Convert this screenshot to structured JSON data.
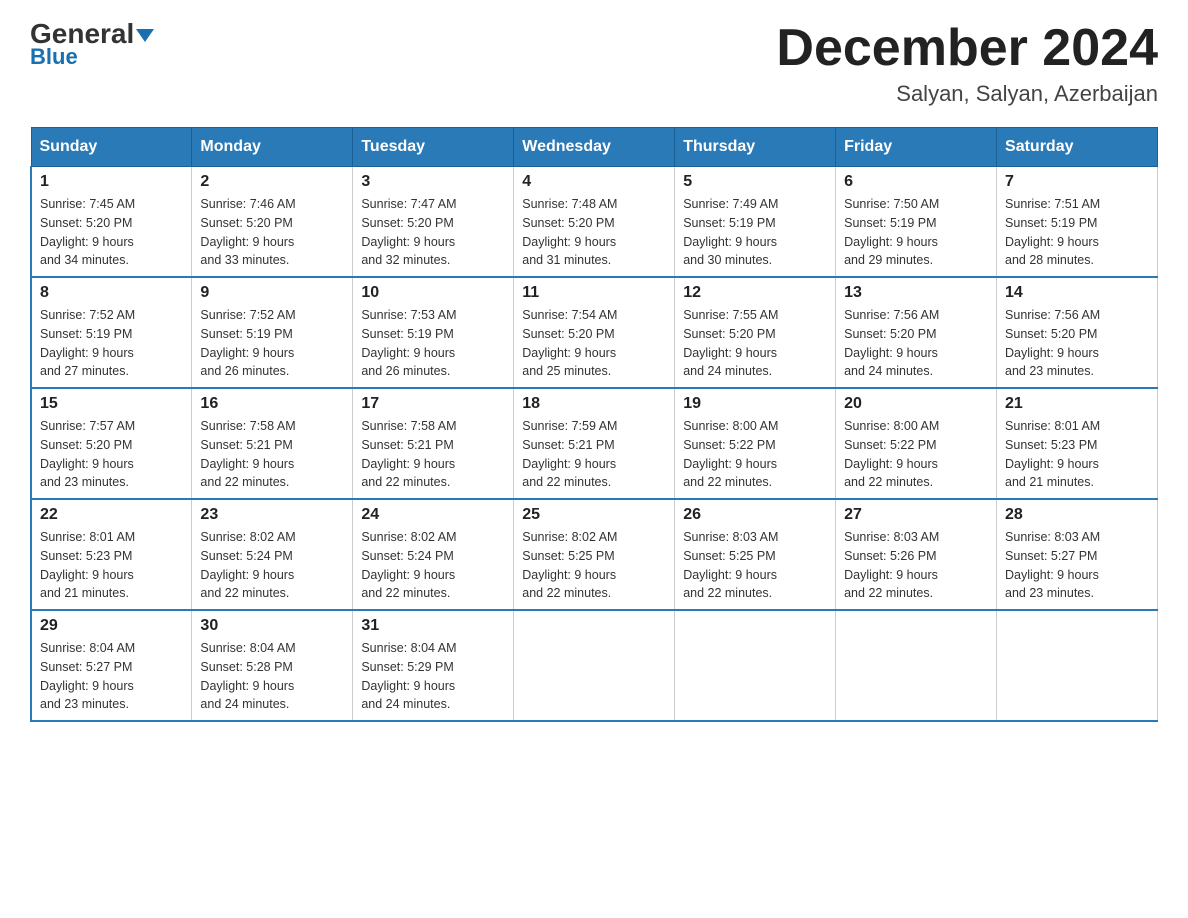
{
  "logo": {
    "general": "General",
    "blue": "Blue"
  },
  "header": {
    "month": "December 2024",
    "location": "Salyan, Salyan, Azerbaijan"
  },
  "days_of_week": [
    "Sunday",
    "Monday",
    "Tuesday",
    "Wednesday",
    "Thursday",
    "Friday",
    "Saturday"
  ],
  "weeks": [
    [
      {
        "day": "1",
        "sunrise": "7:45 AM",
        "sunset": "5:20 PM",
        "daylight": "9 hours and 34 minutes."
      },
      {
        "day": "2",
        "sunrise": "7:46 AM",
        "sunset": "5:20 PM",
        "daylight": "9 hours and 33 minutes."
      },
      {
        "day": "3",
        "sunrise": "7:47 AM",
        "sunset": "5:20 PM",
        "daylight": "9 hours and 32 minutes."
      },
      {
        "day": "4",
        "sunrise": "7:48 AM",
        "sunset": "5:20 PM",
        "daylight": "9 hours and 31 minutes."
      },
      {
        "day": "5",
        "sunrise": "7:49 AM",
        "sunset": "5:19 PM",
        "daylight": "9 hours and 30 minutes."
      },
      {
        "day": "6",
        "sunrise": "7:50 AM",
        "sunset": "5:19 PM",
        "daylight": "9 hours and 29 minutes."
      },
      {
        "day": "7",
        "sunrise": "7:51 AM",
        "sunset": "5:19 PM",
        "daylight": "9 hours and 28 minutes."
      }
    ],
    [
      {
        "day": "8",
        "sunrise": "7:52 AM",
        "sunset": "5:19 PM",
        "daylight": "9 hours and 27 minutes."
      },
      {
        "day": "9",
        "sunrise": "7:52 AM",
        "sunset": "5:19 PM",
        "daylight": "9 hours and 26 minutes."
      },
      {
        "day": "10",
        "sunrise": "7:53 AM",
        "sunset": "5:19 PM",
        "daylight": "9 hours and 26 minutes."
      },
      {
        "day": "11",
        "sunrise": "7:54 AM",
        "sunset": "5:20 PM",
        "daylight": "9 hours and 25 minutes."
      },
      {
        "day": "12",
        "sunrise": "7:55 AM",
        "sunset": "5:20 PM",
        "daylight": "9 hours and 24 minutes."
      },
      {
        "day": "13",
        "sunrise": "7:56 AM",
        "sunset": "5:20 PM",
        "daylight": "9 hours and 24 minutes."
      },
      {
        "day": "14",
        "sunrise": "7:56 AM",
        "sunset": "5:20 PM",
        "daylight": "9 hours and 23 minutes."
      }
    ],
    [
      {
        "day": "15",
        "sunrise": "7:57 AM",
        "sunset": "5:20 PM",
        "daylight": "9 hours and 23 minutes."
      },
      {
        "day": "16",
        "sunrise": "7:58 AM",
        "sunset": "5:21 PM",
        "daylight": "9 hours and 22 minutes."
      },
      {
        "day": "17",
        "sunrise": "7:58 AM",
        "sunset": "5:21 PM",
        "daylight": "9 hours and 22 minutes."
      },
      {
        "day": "18",
        "sunrise": "7:59 AM",
        "sunset": "5:21 PM",
        "daylight": "9 hours and 22 minutes."
      },
      {
        "day": "19",
        "sunrise": "8:00 AM",
        "sunset": "5:22 PM",
        "daylight": "9 hours and 22 minutes."
      },
      {
        "day": "20",
        "sunrise": "8:00 AM",
        "sunset": "5:22 PM",
        "daylight": "9 hours and 22 minutes."
      },
      {
        "day": "21",
        "sunrise": "8:01 AM",
        "sunset": "5:23 PM",
        "daylight": "9 hours and 21 minutes."
      }
    ],
    [
      {
        "day": "22",
        "sunrise": "8:01 AM",
        "sunset": "5:23 PM",
        "daylight": "9 hours and 21 minutes."
      },
      {
        "day": "23",
        "sunrise": "8:02 AM",
        "sunset": "5:24 PM",
        "daylight": "9 hours and 22 minutes."
      },
      {
        "day": "24",
        "sunrise": "8:02 AM",
        "sunset": "5:24 PM",
        "daylight": "9 hours and 22 minutes."
      },
      {
        "day": "25",
        "sunrise": "8:02 AM",
        "sunset": "5:25 PM",
        "daylight": "9 hours and 22 minutes."
      },
      {
        "day": "26",
        "sunrise": "8:03 AM",
        "sunset": "5:25 PM",
        "daylight": "9 hours and 22 minutes."
      },
      {
        "day": "27",
        "sunrise": "8:03 AM",
        "sunset": "5:26 PM",
        "daylight": "9 hours and 22 minutes."
      },
      {
        "day": "28",
        "sunrise": "8:03 AM",
        "sunset": "5:27 PM",
        "daylight": "9 hours and 23 minutes."
      }
    ],
    [
      {
        "day": "29",
        "sunrise": "8:04 AM",
        "sunset": "5:27 PM",
        "daylight": "9 hours and 23 minutes."
      },
      {
        "day": "30",
        "sunrise": "8:04 AM",
        "sunset": "5:28 PM",
        "daylight": "9 hours and 24 minutes."
      },
      {
        "day": "31",
        "sunrise": "8:04 AM",
        "sunset": "5:29 PM",
        "daylight": "9 hours and 24 minutes."
      },
      null,
      null,
      null,
      null
    ]
  ],
  "labels": {
    "sunrise": "Sunrise:",
    "sunset": "Sunset:",
    "daylight": "Daylight:"
  }
}
